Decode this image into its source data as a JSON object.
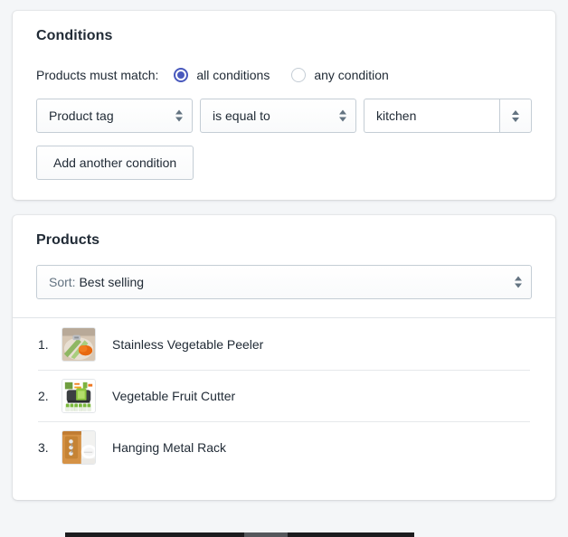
{
  "conditions_card": {
    "title": "Conditions",
    "match_label": "Products must match:",
    "options": [
      {
        "label": "all conditions",
        "selected": true
      },
      {
        "label": "any condition",
        "selected": false
      }
    ],
    "condition_row": {
      "field_select": "Product tag",
      "operator_select": "is equal to",
      "value_input": "kitchen",
      "value_input_placeholder": ""
    },
    "add_condition_label": "Add another condition"
  },
  "products_card": {
    "title": "Products",
    "sort": {
      "prefix": "Sort: ",
      "value": "Best selling"
    },
    "items": [
      {
        "index": "1.",
        "name": "Stainless Vegetable Peeler",
        "thumb": "vegetable-peeler-photo"
      },
      {
        "index": "2.",
        "name": "Vegetable Fruit Cutter",
        "thumb": "vegetable-fruit-cutter-photo"
      },
      {
        "index": "3.",
        "name": "Hanging Metal Rack",
        "thumb": "hanging-metal-rack-photo"
      }
    ]
  },
  "colors": {
    "page_background": "#f4f6f8",
    "card_background": "#ffffff",
    "text": "#212b36",
    "subdued_text": "#637381",
    "border": "#c4cdd5",
    "divider": "#dfe3e8",
    "radio_accent": "#4959bd"
  }
}
